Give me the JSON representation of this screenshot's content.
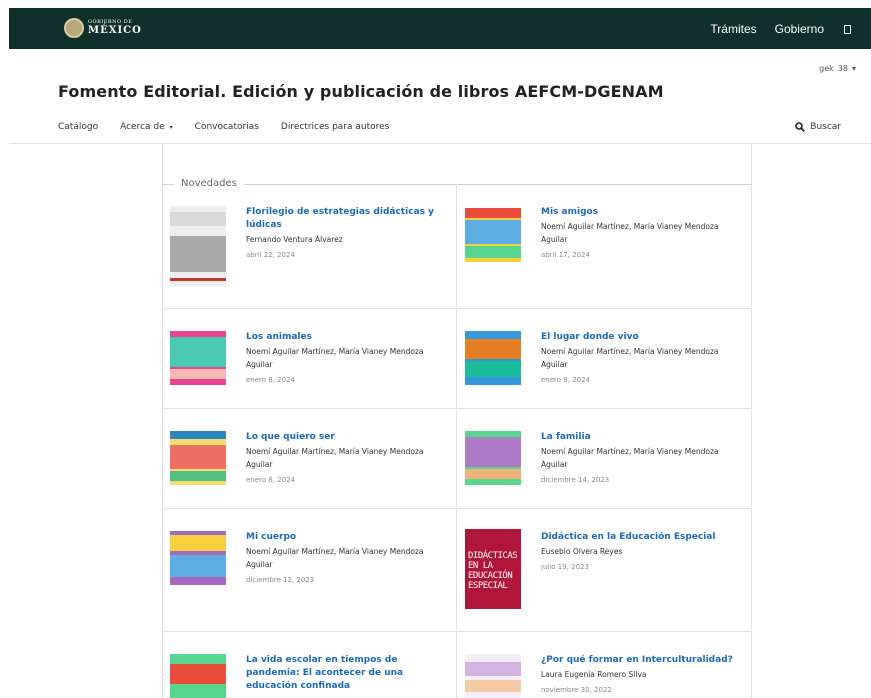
{
  "gov_bar": {
    "logo_small": "GOBIERNO DE",
    "logo_big": "MÉXICO",
    "links": [
      "Trámites",
      "Gobierno"
    ]
  },
  "language": {
    "code": "gek",
    "value": "38"
  },
  "site_title": "Fomento Editorial. Edición y publicación de libros AEFCM-DGENAM",
  "nav": {
    "items": [
      "Catálogo",
      "Acerca de",
      "Convocatorias",
      "Directrices para autores"
    ],
    "search": "Buscar"
  },
  "section_label": "Novedades",
  "books": [
    {
      "title": "Florilegio de estrategias didácticas y lúdicas",
      "authors": "Fernando Ventura Álvarez",
      "date": "abril 22, 2024"
    },
    {
      "title": "Mis amigos",
      "authors": "Noemí Aguilar Martínez, María Vianey Mendoza Aguilar",
      "date": "abril 17, 2024"
    },
    {
      "title": "Los animales",
      "authors": "Noemí Aguilar Martínez, María Vianey Mendoza Aguilar",
      "date": "enero 8, 2024"
    },
    {
      "title": "El lugar donde vivo",
      "authors": "Noemí Aguilar Martínez, María Vianey Mendoza Aguilar",
      "date": "enero 8, 2024"
    },
    {
      "title": "Lo que quiero ser",
      "authors": "Noemí Aguilar Martínez, María Vianey Mendoza Aguilar",
      "date": "enero 8, 2024"
    },
    {
      "title": "La familia",
      "authors": "Noemí Aguilar Martínez, María Vianey Mendoza Aguilar",
      "date": "diciembre 14, 2023"
    },
    {
      "title": "Mi cuerpo",
      "authors": "Noemí Aguilar Martínez, María Vianey Mendoza Aguilar",
      "date": "diciembre 12, 2023"
    },
    {
      "title": "Didáctica en la Educación Especial",
      "authors": "Eusebio Olvera Reyes",
      "date": "julio 19, 2023",
      "cover_text": [
        "DIDÁCTICAS",
        "EN LA",
        "EDUCACIÓN",
        "ESPECIAL"
      ]
    },
    {
      "title": "La vida escolar en tiempos de pandemia: El acontecer de una educación confinada",
      "authors": "",
      "date": ""
    },
    {
      "title": "¿Por qué formar en Interculturalidad?",
      "authors": "Laura Eugenia Romero Silva",
      "date": "noviembre 30, 2022"
    }
  ],
  "colors": {
    "gov_bar": "#10312b",
    "link": "#1b6bb0",
    "didactica_cover": "#b0163a"
  }
}
